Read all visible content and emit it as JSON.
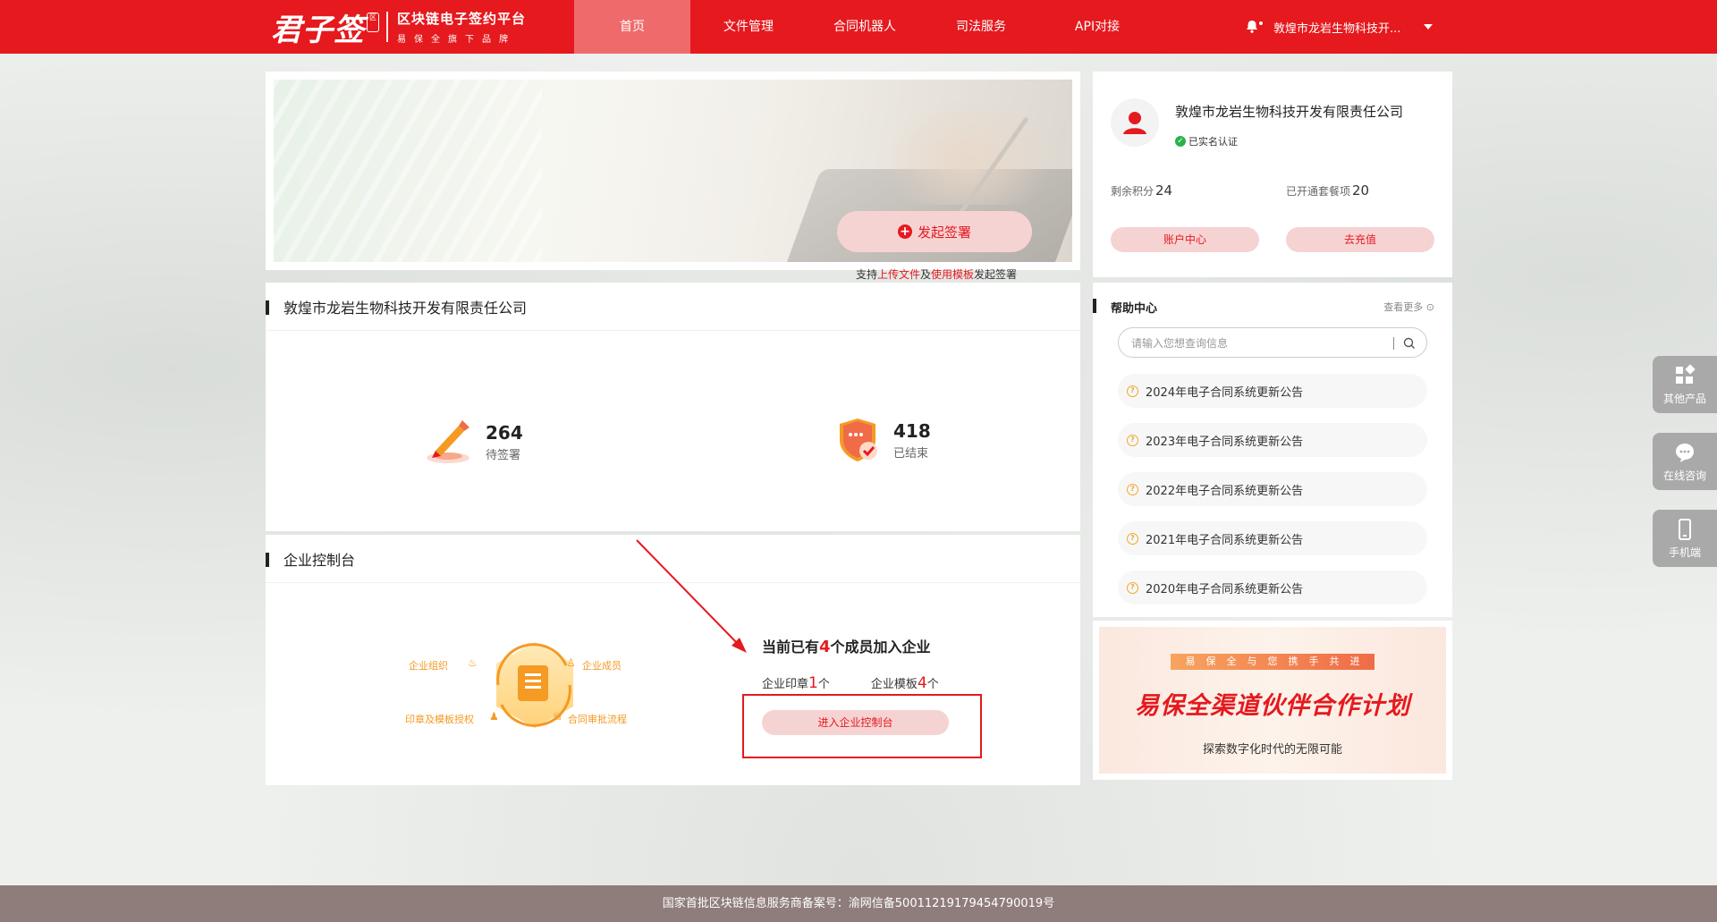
{
  "header": {
    "logo_main": "君子签",
    "logo_seal": "区",
    "logo_title": "区块链电子签约平台",
    "logo_slogan": "易保全旗下品牌",
    "nav": [
      {
        "label": "首页",
        "active": true
      },
      {
        "label": "文件管理"
      },
      {
        "label": "合同机器人"
      },
      {
        "label": "司法服务"
      },
      {
        "label": "API对接"
      }
    ],
    "user_name": "敦煌市龙岩生物科技开..."
  },
  "banner": {
    "sign_label": "发起签署",
    "hint_pre": "支持",
    "hint_link1": "上传文件",
    "hint_mid": "及",
    "hint_link2": "使用模板",
    "hint_post": "发起签署"
  },
  "company": {
    "title": "敦煌市龙岩生物科技开发有限责任公司",
    "pending_count": "264",
    "pending_label": "待签署",
    "finished_count": "418",
    "finished_label": "已结束"
  },
  "console": {
    "title": "企业控制台",
    "labels": {
      "org": "企业组织",
      "members": "企业成员",
      "seal_auth": "印章及模板授权",
      "approval": "合同审批流程"
    },
    "info_pre": "当前已有",
    "member_count": "4",
    "info_post": "个成员加入企业",
    "seal_label": "企业印章",
    "seal_count": "1",
    "seal_unit": "个",
    "template_label": "企业模板",
    "template_count": "4",
    "template_unit": "个",
    "enter_label": "进入企业控制台"
  },
  "profile": {
    "company_name": "敦煌市龙岩生物科技开发有限责任公司",
    "verified_label": "已实名认证",
    "points_label": "剩余积分",
    "points_value": "24",
    "packages_label": "已开通套餐项",
    "packages_value": "20",
    "account_btn": "账户中心",
    "recharge_btn": "去充值"
  },
  "help": {
    "title": "帮助中心",
    "more": "查看更多",
    "search_placeholder": "请输入您想查询信息",
    "notices": [
      "2024年电子合同系统更新公告",
      "2023年电子合同系统更新公告",
      "2022年电子合同系统更新公告",
      "2021年电子合同系统更新公告",
      "2020年电子合同系统更新公告"
    ]
  },
  "promo": {
    "tag": "易保全与您携手共进",
    "title": "易保全渠道伙伴合作计划",
    "subtitle": "探索数字化时代的无限可能"
  },
  "side_tools": [
    {
      "label": "其他产品",
      "icon": "grid-icon"
    },
    {
      "label": "在线咨询",
      "icon": "chat-icon"
    },
    {
      "label": "手机端",
      "icon": "mobile-icon"
    }
  ],
  "footer": {
    "text": "国家首批区块链信息服务商备案号：渝网信备50011219179454790019号"
  },
  "colors": {
    "brand_red": "#e5191e",
    "accent_pink": "#f6d3d3",
    "footer_bg": "#8f7d7b"
  }
}
